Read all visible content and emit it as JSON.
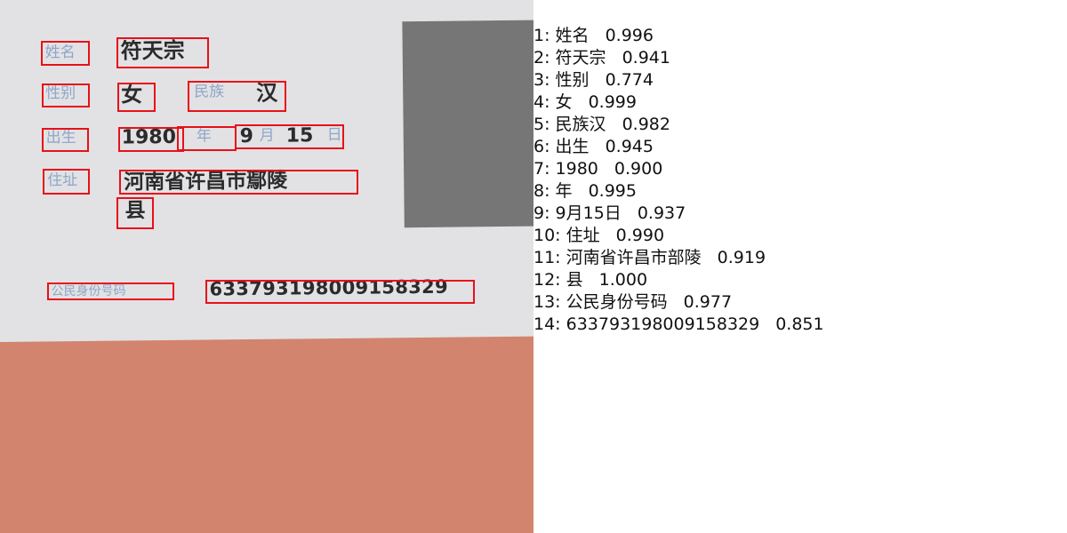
{
  "card": {
    "name_label": "姓名",
    "name_value": "符天宗",
    "sex_label": "性别",
    "sex_value": "女",
    "ethnicity_label": "民族",
    "ethnicity_value": "汉",
    "birth_label": "出生",
    "birth_year": "1980",
    "year_unit": "年",
    "birth_month": "9",
    "month_unit": "月",
    "birth_day": "15",
    "day_unit": "日",
    "address_label": "住址",
    "address_line1": "河南省许昌市鄢陵",
    "address_line2": "县",
    "id_label": "公民身份号码",
    "id_value": "633793198009158329"
  },
  "results": [
    {
      "index": "1:",
      "text": "姓名",
      "score": "0.996"
    },
    {
      "index": "2:",
      "text": "符天宗",
      "score": "0.941"
    },
    {
      "index": "3:",
      "text": "性别",
      "score": "0.774"
    },
    {
      "index": "4:",
      "text": "女",
      "score": "0.999"
    },
    {
      "index": "5:",
      "text": "民族汉",
      "score": "0.982"
    },
    {
      "index": "6:",
      "text": "出生",
      "score": "0.945"
    },
    {
      "index": "7:",
      "text": "1980",
      "score": "0.900"
    },
    {
      "index": "8:",
      "text": "年",
      "score": "0.995"
    },
    {
      "index": "9:",
      "text": "9月15日",
      "score": "0.937"
    },
    {
      "index": "10:",
      "text": "住址",
      "score": "0.990"
    },
    {
      "index": "11:",
      "text": "河南省许昌市部陵",
      "score": "0.919"
    },
    {
      "index": "12:",
      "text": "县",
      "score": "1.000"
    },
    {
      "index": "13:",
      "text": "公民身份号码",
      "score": "0.977"
    },
    {
      "index": "14:",
      "text": "633793198009158329",
      "score": "0.851"
    }
  ],
  "colors": {
    "background_card": "#e2e2e4",
    "background_below": "#d3846e",
    "photo_placeholder": "#767676",
    "box_stroke": "#e8101a",
    "label_text": "#8fa6c8"
  }
}
